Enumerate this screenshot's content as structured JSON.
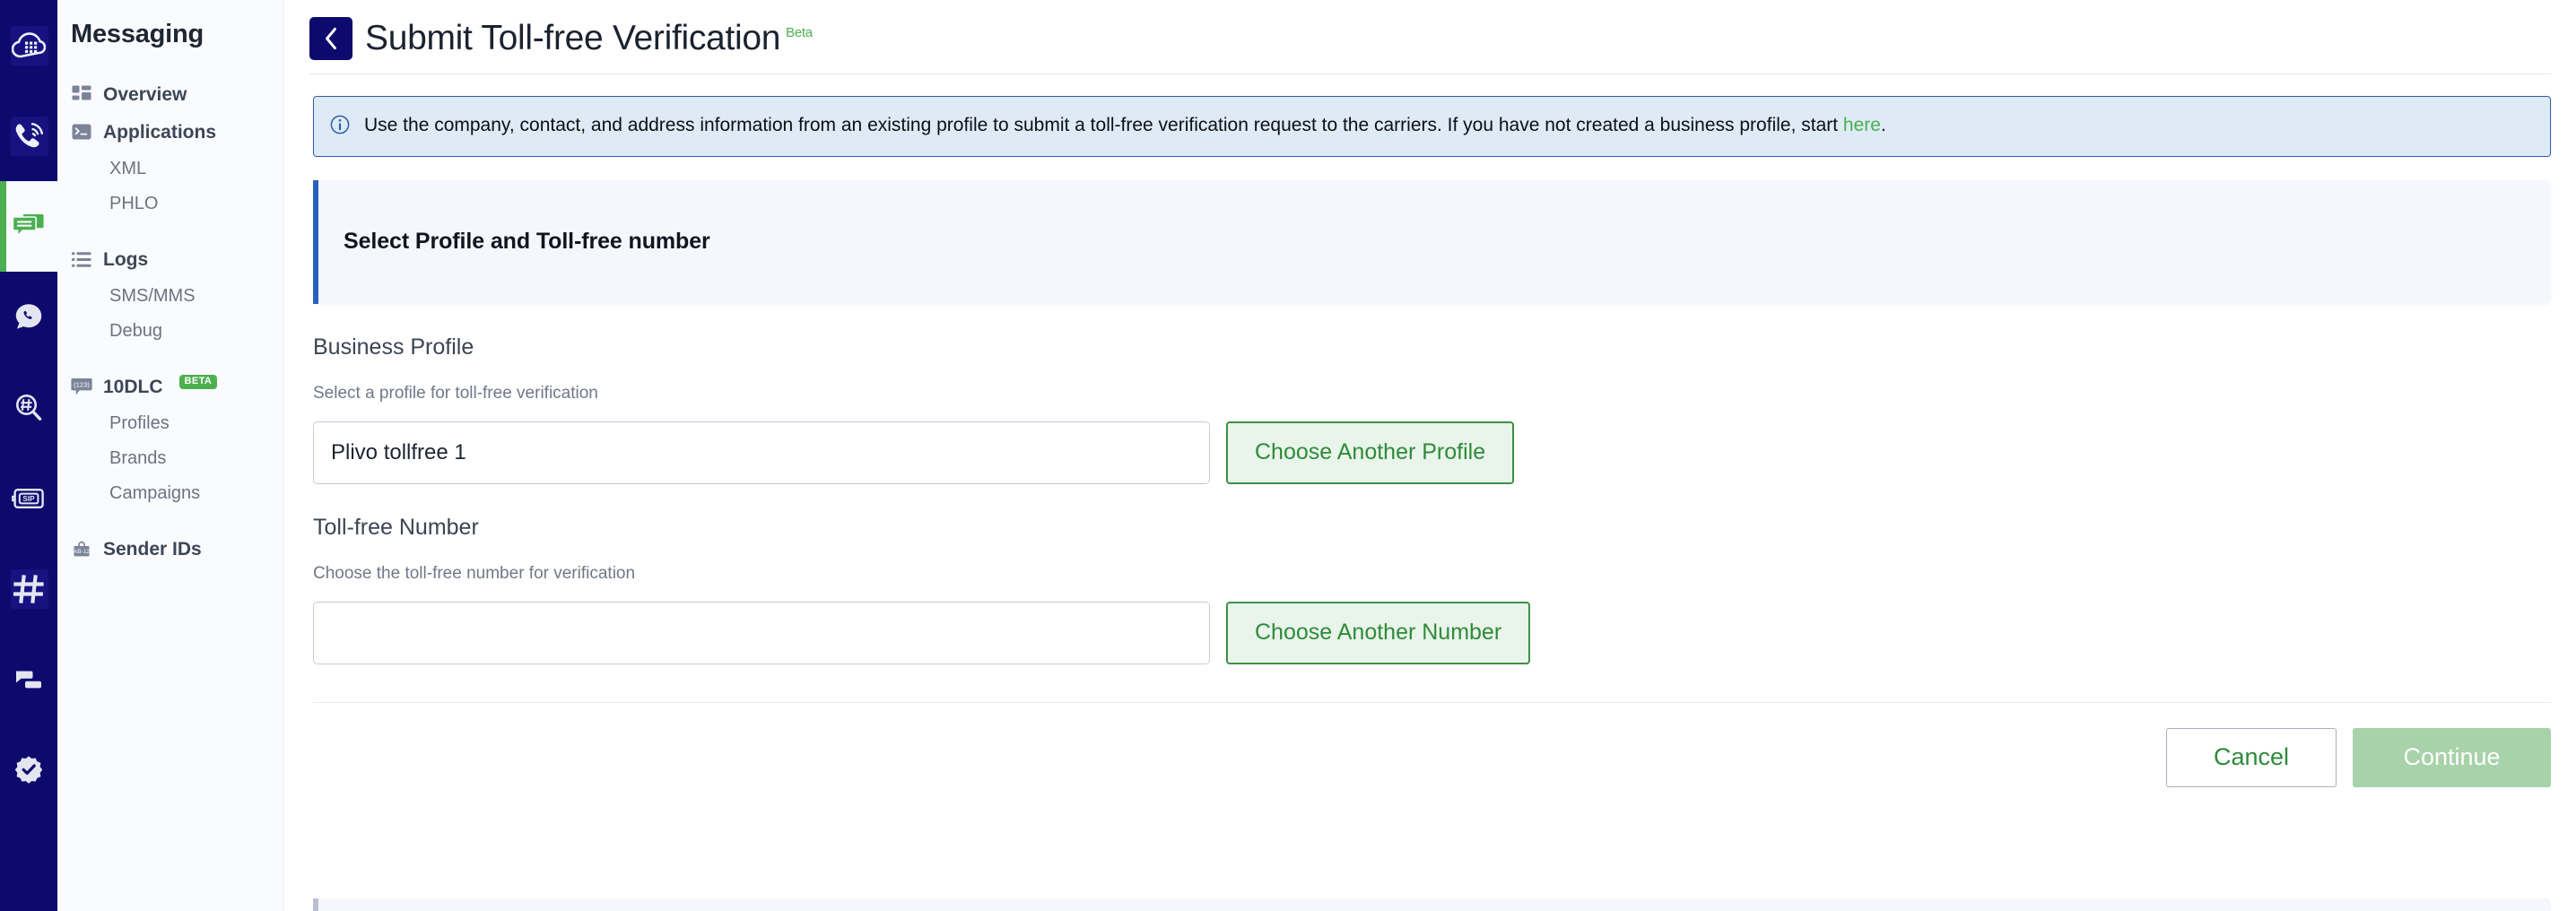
{
  "icon_rail": {
    "items": [
      {
        "name": "cloud-keypad-icon",
        "active": false,
        "tinted": true
      },
      {
        "name": "voice-call-icon",
        "active": false,
        "tinted": true
      },
      {
        "name": "messaging-icon",
        "active": true,
        "tinted": false
      },
      {
        "name": "whatsapp-icon",
        "active": false,
        "tinted": false
      },
      {
        "name": "number-lookup-icon",
        "active": false,
        "tinted": false
      },
      {
        "name": "sip-trunking-icon",
        "active": false,
        "tinted": false
      },
      {
        "name": "phone-numbers-icon",
        "active": false,
        "tinted": true
      },
      {
        "name": "zentrunk-icon",
        "active": false,
        "tinted": false
      },
      {
        "name": "verify-icon",
        "active": false,
        "tinted": false
      }
    ]
  },
  "sidebar": {
    "title": "Messaging",
    "groups": [
      {
        "label": "Overview",
        "icon": "dashboard-icon",
        "badge": null,
        "children": []
      },
      {
        "label": "Applications",
        "icon": "terminal-icon",
        "badge": null,
        "children": [
          "XML",
          "PHLO"
        ]
      },
      {
        "label": "Logs",
        "icon": "list-icon",
        "badge": null,
        "children": [
          "SMS/MMS",
          "Debug"
        ]
      },
      {
        "label": "10DLC",
        "icon": "numeric-bubble-icon",
        "badge": "BETA",
        "children": [
          "Profiles",
          "Brands",
          "Campaigns"
        ]
      },
      {
        "label": "Sender IDs",
        "icon": "sender-id-icon",
        "badge": null,
        "children": []
      }
    ]
  },
  "header": {
    "back_label": "‹",
    "title": "Submit Toll-free Verification",
    "beta_label": "Beta"
  },
  "banner": {
    "icon": "info-icon",
    "text_before": "Use the company, contact, and address information from an existing profile to submit a toll-free verification request to the carriers. If you have not created a business profile, start ",
    "link_label": "here",
    "text_after": "."
  },
  "section": {
    "heading": "Select Profile and Toll-free number"
  },
  "form": {
    "business_profile": {
      "label": "Business Profile",
      "help": "Select a profile for toll-free verification",
      "value": "Plivo tollfree 1",
      "placeholder": "",
      "button_label": "Choose Another Profile"
    },
    "tollfree_number": {
      "label": "Toll-free Number",
      "help": "Choose the toll-free number for verification",
      "value": "",
      "placeholder": "",
      "button_label": "Choose Another Number"
    }
  },
  "footer": {
    "cancel_label": "Cancel",
    "continue_label": "Continue"
  },
  "colors": {
    "rail_navy": "#0d0a6e",
    "accent_green": "#4caf50",
    "section_accent_blue": "#2861bd",
    "banner_bg": "#deebf7",
    "banner_border": "#2a5fa8",
    "continue_disabled": "#a8d2a9"
  }
}
